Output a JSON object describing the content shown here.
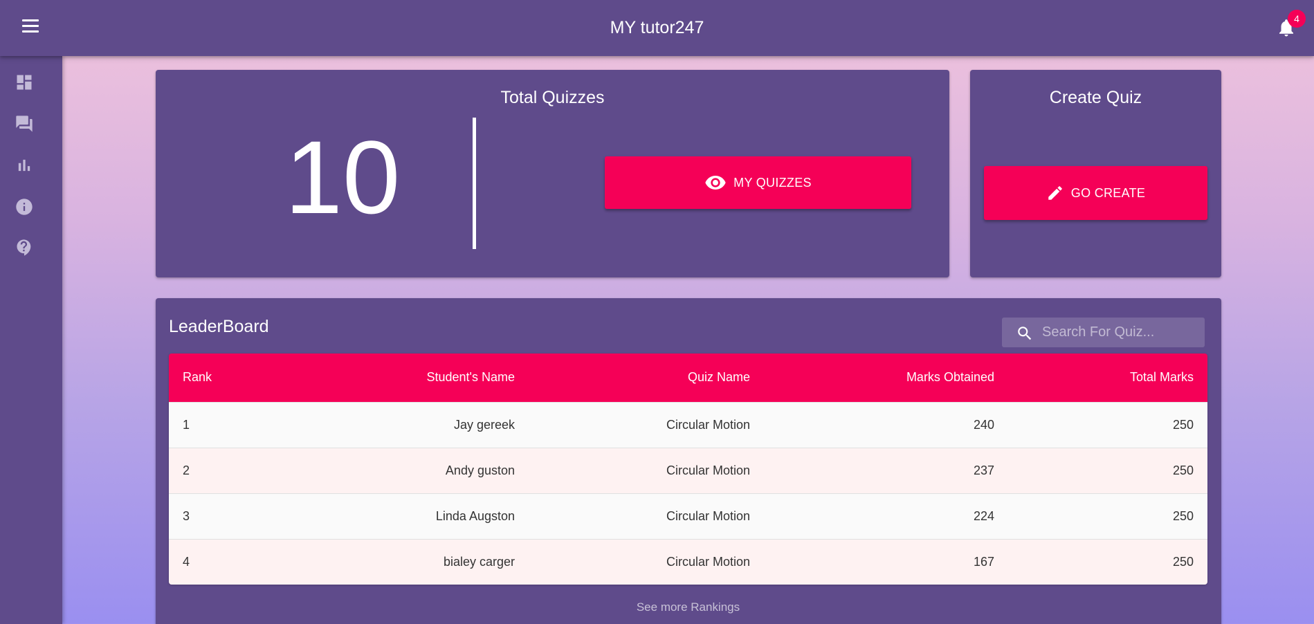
{
  "app": {
    "title": "MY tutor247",
    "notification_count": "4"
  },
  "sidebar": {
    "items": [
      {
        "icon": "dashboard-icon"
      },
      {
        "icon": "forum-icon"
      },
      {
        "icon": "bar-chart-icon"
      },
      {
        "icon": "info-icon"
      },
      {
        "icon": "help-icon"
      }
    ]
  },
  "total_quizzes": {
    "title": "Total Quizzes",
    "count": "10",
    "button_label": "MY QUIZZES",
    "button_icon": "eye-icon"
  },
  "create_quiz": {
    "title": "Create Quiz",
    "button_label": "GO CREATE",
    "button_icon": "pencil-icon"
  },
  "leaderboard": {
    "title": "LeaderBoard",
    "search_placeholder": "Search For Quiz...",
    "columns": [
      "Rank",
      "Student's Name",
      "Quiz Name",
      "Marks Obtained",
      "Total Marks"
    ],
    "rows": [
      [
        "1",
        "Jay gereek",
        "Circular Motion",
        "240",
        "250"
      ],
      [
        "2",
        "Andy guston",
        "Circular Motion",
        "237",
        "250"
      ],
      [
        "3",
        "Linda Augston",
        "Circular Motion",
        "224",
        "250"
      ],
      [
        "4",
        "bialey carger",
        "Circular Motion",
        "167",
        "250"
      ]
    ],
    "see_more": "See more Rankings"
  },
  "colors": {
    "primary": "#5f4b8b",
    "accent": "#f50057"
  }
}
